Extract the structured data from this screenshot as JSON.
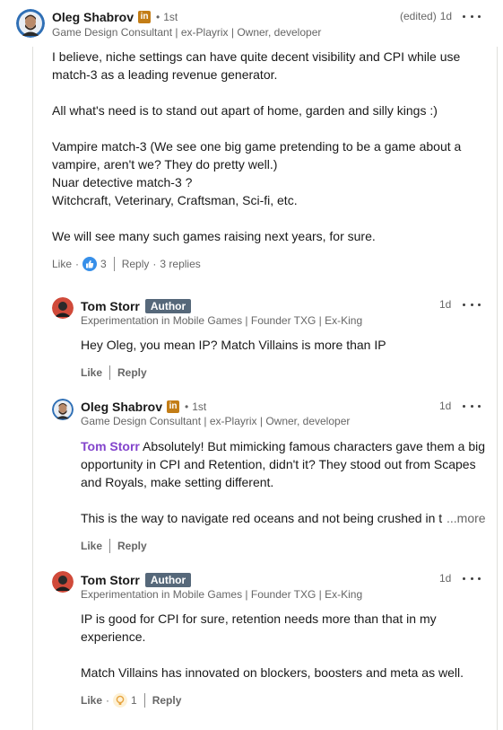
{
  "comments": [
    {
      "name": "Oleg Shabrov",
      "linkedin_badge": "in",
      "degree": "1st",
      "headline": "Game Design Consultant | ex-Playrix | Owner, developer",
      "edited": "(edited)",
      "time": "1d",
      "paragraphs": [
        [
          "I believe, niche settings can have quite decent visibility and CPI while use",
          "match-3 as a leading revenue generator."
        ],
        [
          "All what's need is to stand out apart of home, garden and silly kings :)"
        ],
        [
          "Vampire match-3 (We see one big game pretending to be a game about a",
          "vampire, aren't we? They do pretty well.)",
          "Nuar detective match-3 ?",
          "Witchcraft, Veterinary, Craftsman, Sci-fi, etc."
        ],
        [
          "We will see many such games raising next years, for sure."
        ]
      ],
      "actions": {
        "like": "Like",
        "reaction_count": "3",
        "reply": "Reply",
        "replies": "3 replies",
        "reaction_icon": "thumbs-up-icon"
      }
    },
    {
      "name": "Tom Storr",
      "author_badge": "Author",
      "headline": "Experimentation in Mobile Games | Founder TXG | Ex-King",
      "time": "1d",
      "text": "Hey Oleg, you mean IP? Match Villains is more than IP",
      "actions": {
        "like": "Like",
        "reply": "Reply"
      }
    },
    {
      "name": "Oleg Shabrov",
      "linkedin_badge": "in",
      "degree": "1st",
      "headline": "Game Design Consultant | ex-Playrix | Owner, developer",
      "time": "1d",
      "mention": "Tom Storr",
      "lines": [
        " Absolutely! But mimicking famous characters gave them a big",
        "opportunity in CPI and Retention, didn't it? They stood out from Scapes",
        "and Royals, make setting different."
      ],
      "truncated_line": "This is the way to navigate red oceans and not being crushed in the",
      "see_more": "...more",
      "actions": {
        "like": "Like",
        "reply": "Reply"
      }
    },
    {
      "name": "Tom Storr",
      "author_badge": "Author",
      "headline": "Experimentation in Mobile Games | Founder TXG | Ex-King",
      "time": "1d",
      "paragraphs": [
        [
          "IP is good for CPI for sure, retention needs more than that in my",
          "experience."
        ],
        [
          "Match Villains has innovated on blockers, boosters and meta as well."
        ]
      ],
      "actions": {
        "like": "Like",
        "reaction_count": "1",
        "reply": "Reply",
        "reaction_icon": "insightful-icon"
      }
    }
  ],
  "colors": {
    "mention": "#8344cc",
    "author_badge": "#56687a",
    "linkedin_badge": "#c37d16",
    "like_blue": "#378fe9",
    "insightful": "#f5bb5c"
  }
}
